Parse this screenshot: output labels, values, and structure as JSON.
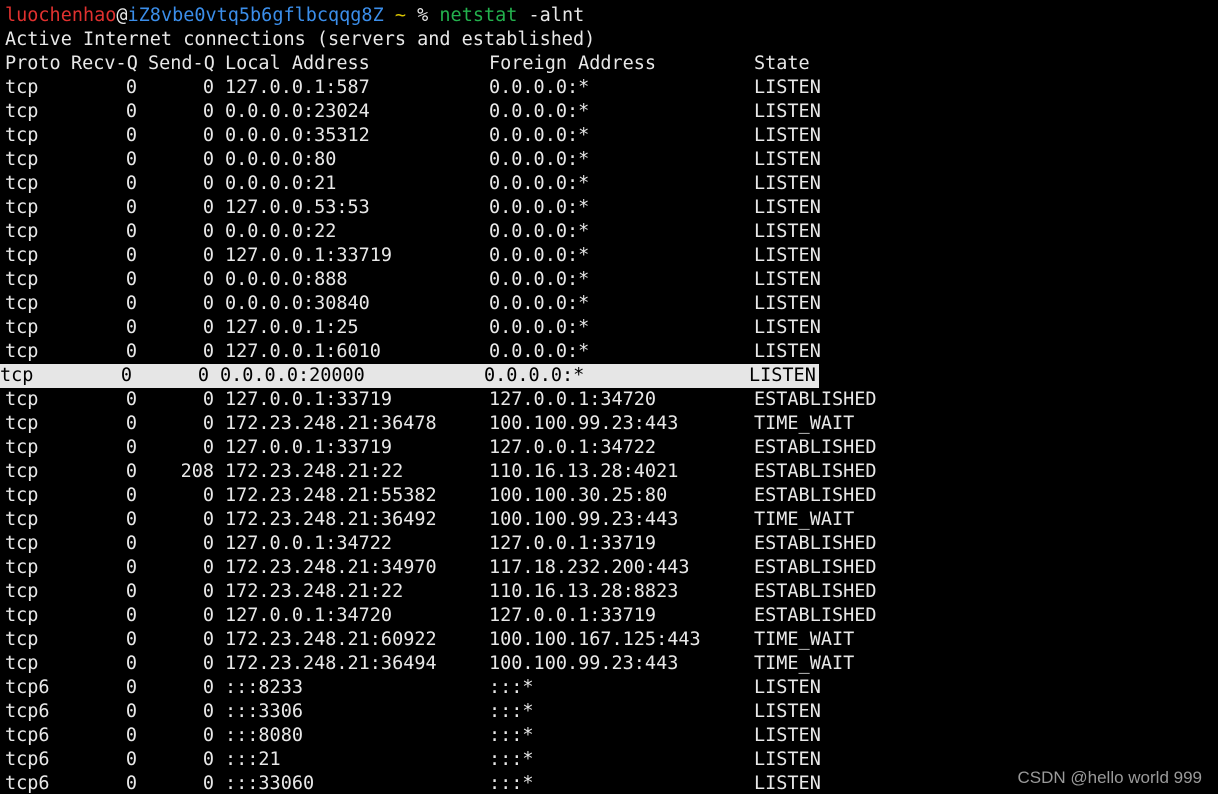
{
  "prompt": {
    "user": "luochenhao",
    "at": "@",
    "host": "iZ8vbe0vtq5b6gflbcqqg8Z",
    "tilde": "~",
    "symbol": "%",
    "command": "netstat",
    "args": "-alnt"
  },
  "summary": "Active Internet connections (servers and established)",
  "headers": {
    "proto": "Proto",
    "recv": "Recv-Q",
    "send": "Send-Q",
    "local": "Local Address",
    "foreign": "Foreign Address",
    "state": "State"
  },
  "highlighted_row_index": 12,
  "rows": [
    {
      "proto": "tcp",
      "recv": "0",
      "send": "0",
      "local": "127.0.0.1:587",
      "foreign": "0.0.0.0:*",
      "state": "LISTEN"
    },
    {
      "proto": "tcp",
      "recv": "0",
      "send": "0",
      "local": "0.0.0.0:23024",
      "foreign": "0.0.0.0:*",
      "state": "LISTEN"
    },
    {
      "proto": "tcp",
      "recv": "0",
      "send": "0",
      "local": "0.0.0.0:35312",
      "foreign": "0.0.0.0:*",
      "state": "LISTEN"
    },
    {
      "proto": "tcp",
      "recv": "0",
      "send": "0",
      "local": "0.0.0.0:80",
      "foreign": "0.0.0.0:*",
      "state": "LISTEN"
    },
    {
      "proto": "tcp",
      "recv": "0",
      "send": "0",
      "local": "0.0.0.0:21",
      "foreign": "0.0.0.0:*",
      "state": "LISTEN"
    },
    {
      "proto": "tcp",
      "recv": "0",
      "send": "0",
      "local": "127.0.0.53:53",
      "foreign": "0.0.0.0:*",
      "state": "LISTEN"
    },
    {
      "proto": "tcp",
      "recv": "0",
      "send": "0",
      "local": "0.0.0.0:22",
      "foreign": "0.0.0.0:*",
      "state": "LISTEN"
    },
    {
      "proto": "tcp",
      "recv": "0",
      "send": "0",
      "local": "127.0.0.1:33719",
      "foreign": "0.0.0.0:*",
      "state": "LISTEN"
    },
    {
      "proto": "tcp",
      "recv": "0",
      "send": "0",
      "local": "0.0.0.0:888",
      "foreign": "0.0.0.0:*",
      "state": "LISTEN"
    },
    {
      "proto": "tcp",
      "recv": "0",
      "send": "0",
      "local": "0.0.0.0:30840",
      "foreign": "0.0.0.0:*",
      "state": "LISTEN"
    },
    {
      "proto": "tcp",
      "recv": "0",
      "send": "0",
      "local": "127.0.0.1:25",
      "foreign": "0.0.0.0:*",
      "state": "LISTEN"
    },
    {
      "proto": "tcp",
      "recv": "0",
      "send": "0",
      "local": "127.0.0.1:6010",
      "foreign": "0.0.0.0:*",
      "state": "LISTEN"
    },
    {
      "proto": "tcp",
      "recv": "0",
      "send": "0",
      "local": "0.0.0.0:20000",
      "foreign": "0.0.0.0:*",
      "state": "LISTEN"
    },
    {
      "proto": "tcp",
      "recv": "0",
      "send": "0",
      "local": "127.0.0.1:33719",
      "foreign": "127.0.0.1:34720",
      "state": "ESTABLISHED"
    },
    {
      "proto": "tcp",
      "recv": "0",
      "send": "0",
      "local": "172.23.248.21:36478",
      "foreign": "100.100.99.23:443",
      "state": "TIME_WAIT"
    },
    {
      "proto": "tcp",
      "recv": "0",
      "send": "0",
      "local": "127.0.0.1:33719",
      "foreign": "127.0.0.1:34722",
      "state": "ESTABLISHED"
    },
    {
      "proto": "tcp",
      "recv": "0",
      "send": "208",
      "local": "172.23.248.21:22",
      "foreign": "110.16.13.28:4021",
      "state": "ESTABLISHED"
    },
    {
      "proto": "tcp",
      "recv": "0",
      "send": "0",
      "local": "172.23.248.21:55382",
      "foreign": "100.100.30.25:80",
      "state": "ESTABLISHED"
    },
    {
      "proto": "tcp",
      "recv": "0",
      "send": "0",
      "local": "172.23.248.21:36492",
      "foreign": "100.100.99.23:443",
      "state": "TIME_WAIT"
    },
    {
      "proto": "tcp",
      "recv": "0",
      "send": "0",
      "local": "127.0.0.1:34722",
      "foreign": "127.0.0.1:33719",
      "state": "ESTABLISHED"
    },
    {
      "proto": "tcp",
      "recv": "0",
      "send": "0",
      "local": "172.23.248.21:34970",
      "foreign": "117.18.232.200:443",
      "state": "ESTABLISHED"
    },
    {
      "proto": "tcp",
      "recv": "0",
      "send": "0",
      "local": "172.23.248.21:22",
      "foreign": "110.16.13.28:8823",
      "state": "ESTABLISHED"
    },
    {
      "proto": "tcp",
      "recv": "0",
      "send": "0",
      "local": "127.0.0.1:34720",
      "foreign": "127.0.0.1:33719",
      "state": "ESTABLISHED"
    },
    {
      "proto": "tcp",
      "recv": "0",
      "send": "0",
      "local": "172.23.248.21:60922",
      "foreign": "100.100.167.125:443",
      "state": "TIME_WAIT"
    },
    {
      "proto": "tcp",
      "recv": "0",
      "send": "0",
      "local": "172.23.248.21:36494",
      "foreign": "100.100.99.23:443",
      "state": "TIME_WAIT"
    },
    {
      "proto": "tcp6",
      "recv": "0",
      "send": "0",
      "local": ":::8233",
      "foreign": ":::*",
      "state": "LISTEN"
    },
    {
      "proto": "tcp6",
      "recv": "0",
      "send": "0",
      "local": ":::3306",
      "foreign": ":::*",
      "state": "LISTEN"
    },
    {
      "proto": "tcp6",
      "recv": "0",
      "send": "0",
      "local": ":::8080",
      "foreign": ":::*",
      "state": "LISTEN"
    },
    {
      "proto": "tcp6",
      "recv": "0",
      "send": "0",
      "local": ":::21",
      "foreign": ":::*",
      "state": "LISTEN"
    },
    {
      "proto": "tcp6",
      "recv": "0",
      "send": "0",
      "local": ":::33060",
      "foreign": ":::*",
      "state": "LISTEN"
    }
  ],
  "watermark": "CSDN @hello world 999"
}
